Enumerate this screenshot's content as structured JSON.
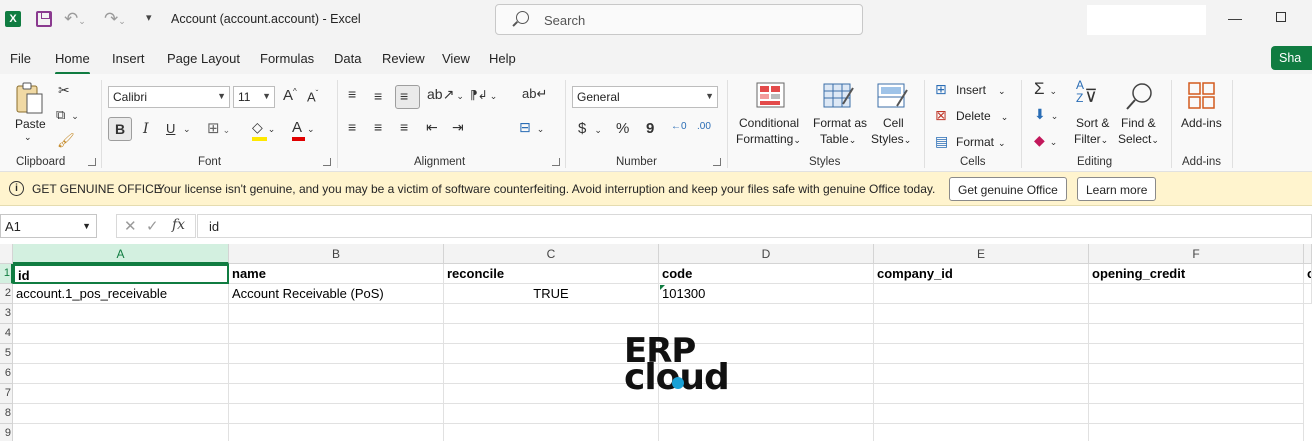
{
  "titlebar": {
    "app_icon": "excel-icon",
    "doc_title": "Account (account.account)  -  Excel",
    "search_placeholder": "Search"
  },
  "tabs": [
    "File",
    "Home",
    "Insert",
    "Page Layout",
    "Formulas",
    "Data",
    "Review",
    "View",
    "Help"
  ],
  "active_tab": "Home",
  "share_label": "Sha",
  "ribbon": {
    "clipboard": {
      "paste": "Paste",
      "label": "Clipboard"
    },
    "font": {
      "name": "Calibri",
      "size": "11",
      "bold": "B",
      "italic": "I",
      "underline": "U",
      "label": "Font"
    },
    "alignment": {
      "label": "Alignment"
    },
    "number": {
      "format": "General",
      "currency": "$",
      "percent": "%",
      "comma": "9",
      "label": "Number"
    },
    "styles": {
      "conditional_1": "Conditional",
      "conditional_2": "Formatting",
      "format_table_1": "Format as",
      "format_table_2": "Table",
      "cell_styles_1": "Cell",
      "cell_styles_2": "Styles",
      "label": "Styles"
    },
    "cells": {
      "insert": "Insert",
      "delete": "Delete",
      "format": "Format",
      "label": "Cells"
    },
    "editing": {
      "sort_1": "Sort &",
      "sort_2": "Filter",
      "find_1": "Find &",
      "find_2": "Select",
      "label": "Editing"
    },
    "addins": {
      "button": "Add-ins",
      "label": "Add-ins"
    }
  },
  "infobar": {
    "title": "GET GENUINE OFFICE",
    "message": "Your license isn't genuine, and you may be a victim of software counterfeiting. Avoid interruption and keep your files safe with genuine Office today.",
    "btn_genuine": "Get genuine Office",
    "btn_learn": "Learn more"
  },
  "formula_bar": {
    "name_box": "A1",
    "cancel": "✕",
    "enter": "✓",
    "fx": "fx",
    "formula": "id"
  },
  "grid": {
    "columns": [
      "A",
      "B",
      "C",
      "D",
      "E",
      "F"
    ],
    "rows": [
      "1",
      "2",
      "3",
      "4",
      "5",
      "6",
      "7",
      "8",
      "9"
    ],
    "header_row": [
      "id",
      "name",
      "reconcile",
      "code",
      "company_id",
      "opening_credit",
      "o"
    ],
    "data_row": [
      "account.1_pos_receivable",
      "Account Receivable (PoS)",
      "TRUE",
      "101300",
      "",
      "",
      ""
    ]
  },
  "logo": {
    "line1": "ERP",
    "line2": "cloud"
  }
}
